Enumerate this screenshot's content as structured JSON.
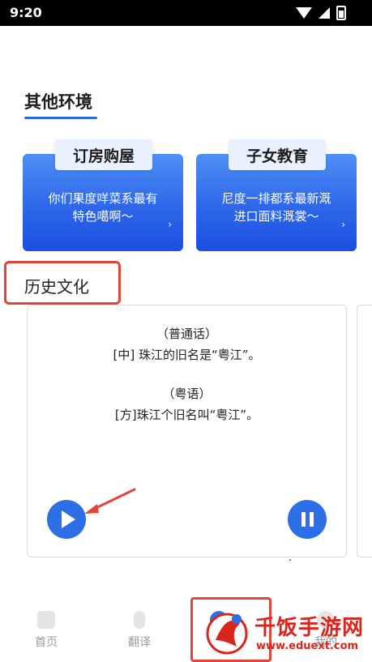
{
  "status_bar": {
    "time": "9:20"
  },
  "section": {
    "title": "其他环境"
  },
  "env_cards": [
    {
      "label": "订房购屋",
      "desc_line1": "你们果度咩菜系最有",
      "desc_line2": "特色噶啊～",
      "arrow": "›"
    },
    {
      "label": "子女教育",
      "desc_line1": "尼度一排都系最新溉",
      "desc_line2": "进口面料溉裳～",
      "arrow": "›"
    }
  ],
  "history": {
    "title": "历史文化"
  },
  "dialog": {
    "mandarin_label": "（普通话）",
    "mandarin_text": "[中] 珠江的旧名是“粤江”。",
    "cantonese_label": "（粤语）",
    "cantonese_text": "[方]珠江个旧名叫“粤江”。"
  },
  "nav": {
    "home": "首页",
    "translate": "翻译",
    "active": "",
    "mine": "我的"
  },
  "watermark": {
    "title": "千饭手游网",
    "url": "www.eduext.com"
  },
  "colors": {
    "accent": "#2c6fe6",
    "highlight": "#e0473a"
  }
}
